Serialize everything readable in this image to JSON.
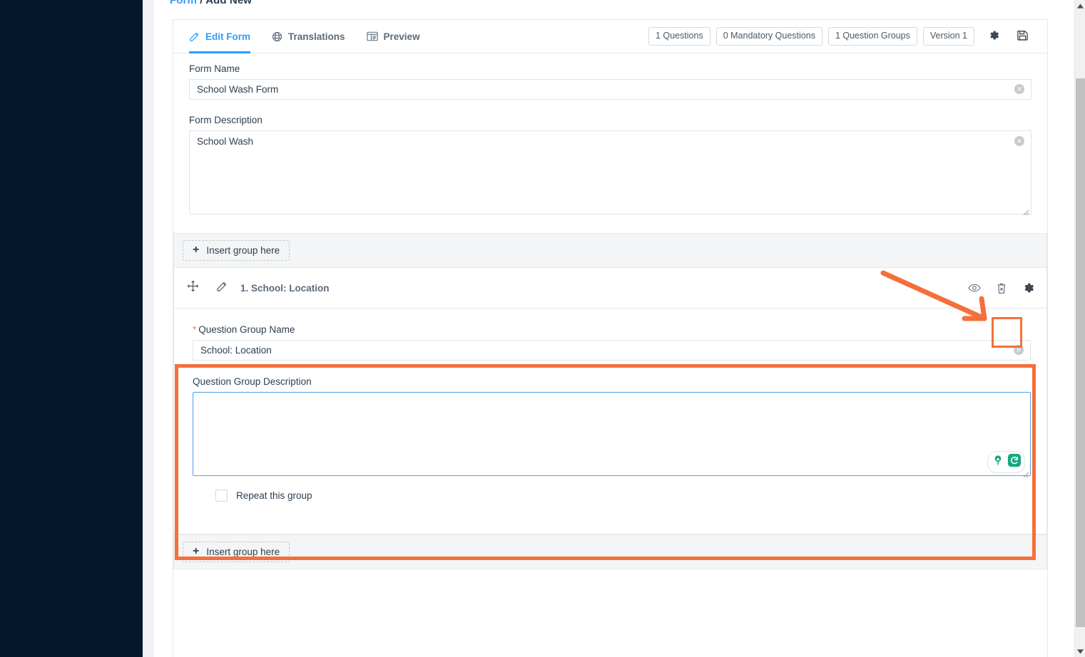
{
  "breadcrumb": {
    "link": "Form",
    "separator": "/",
    "current": "Add New"
  },
  "tabs": [
    {
      "label": "Edit Form",
      "icon": "pencil-square-icon",
      "active": true
    },
    {
      "label": "Translations",
      "icon": "globe-icon",
      "active": false
    },
    {
      "label": "Preview",
      "icon": "preview-layout-icon",
      "active": false
    }
  ],
  "toolbar": {
    "badges": [
      "1 Questions",
      "0 Mandatory Questions",
      "1 Question Groups",
      "Version 1"
    ],
    "settings_icon": "gear-icon",
    "save_icon": "floppy-save-icon"
  },
  "form": {
    "name_label": "Form Name",
    "name_value": "School Wash Form",
    "name_placeholder": "Form Name",
    "description_label": "Form Description",
    "description_value": "School Wash",
    "description_placeholder": "Form Description",
    "clear_icon": "clear-circle-icon"
  },
  "insert_group_top": {
    "label": "Insert group here",
    "icon": "plus-icon"
  },
  "insert_group_bottom": {
    "label": "Insert group here",
    "icon": "plus-icon"
  },
  "question_group": {
    "drag_icon": "move-arrows-icon",
    "edit_icon": "pencil-icon",
    "title": "1. School: Location",
    "preview_icon": "eye-icon",
    "delete_icon": "trash-icon",
    "settings_icon": "gear-icon"
  },
  "group_settings": {
    "name_label": "Question Group Name",
    "name_required_mark": "*",
    "name_value": "School: Location",
    "name_placeholder": "Question Group Name",
    "clear_icon": "clear-circle-icon",
    "description_label": "Question Group Description",
    "description_value": "",
    "description_placeholder": "",
    "grammarly_icons": [
      "lightbulb-icon",
      "grammarly-g-icon"
    ],
    "repeat_label": "Repeat this group",
    "repeat_checked": false
  },
  "colors": {
    "accent_blue": "#2f9bff",
    "annotation_orange": "#f4703a",
    "sidebar_navy": "#03182c",
    "required_red": "#ef7470",
    "grammarly_green": "#15a87f"
  },
  "scrollbar": {
    "up_icon": "scroll-up-arrow-icon",
    "down_icon": "scroll-down-arrow-icon"
  }
}
